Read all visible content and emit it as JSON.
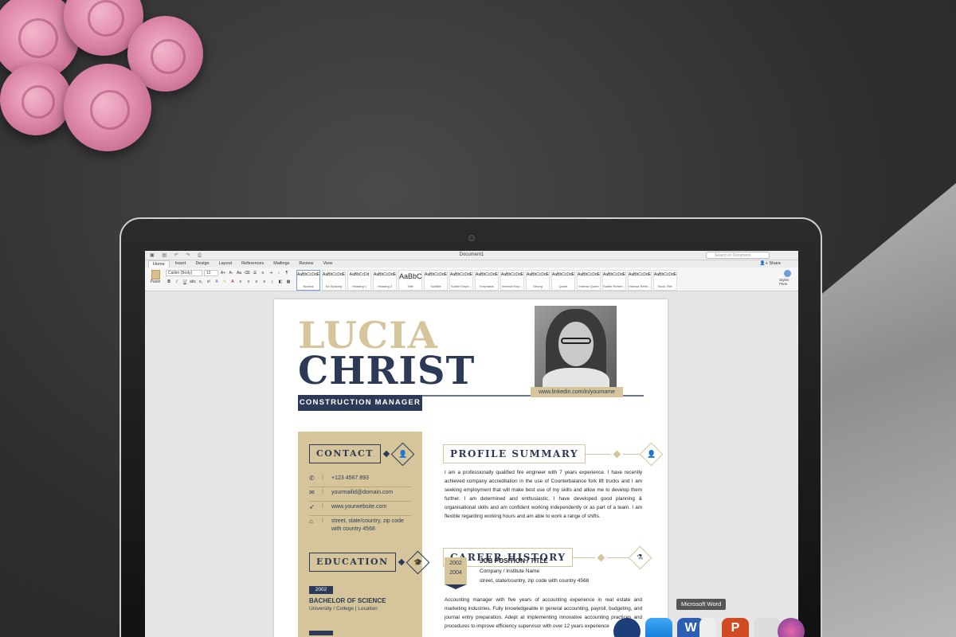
{
  "word": {
    "document_title": "Document1",
    "search_placeholder": "Search in Document",
    "tabs": [
      "Home",
      "Insert",
      "Design",
      "Layout",
      "References",
      "Mailings",
      "Review",
      "View"
    ],
    "share_label": "Share",
    "paste_label": "Paste",
    "font_name": "Calibri (Body)",
    "font_size": "12",
    "styles": [
      {
        "preview": "AaBbCcDdEe",
        "name": "Normal"
      },
      {
        "preview": "AaBbCcDdEe",
        "name": "No Spacing"
      },
      {
        "preview": "AaBbCcDd",
        "name": "Heading 1"
      },
      {
        "preview": "AaBbCcDdEe",
        "name": "Heading 2"
      },
      {
        "preview": "AaBbC",
        "name": "Title"
      },
      {
        "preview": "AaBbCcDdEe",
        "name": "Subtitle"
      },
      {
        "preview": "AaBbCcDdEe",
        "name": "Subtle Emph..."
      },
      {
        "preview": "AaBbCcDdEe",
        "name": "Emphasis"
      },
      {
        "preview": "AaBbCcDdEe",
        "name": "Intense Emp..."
      },
      {
        "preview": "AaBbCcDdEe",
        "name": "Strong"
      },
      {
        "preview": "AaBbCcDdEe",
        "name": "Quote"
      },
      {
        "preview": "AaBbCcDdEe",
        "name": "Intense Quote"
      },
      {
        "preview": "AaBbCcDdEe",
        "name": "Subtle Refere..."
      },
      {
        "preview": "AaBbCcDdEe",
        "name": "Intense Refer..."
      },
      {
        "preview": "AaBbCcDdEe",
        "name": "Book Title"
      }
    ],
    "styles_pane_label": "Styles Pane"
  },
  "resume": {
    "first_name": "LUCIA",
    "last_name": "CHRIST",
    "job_title": "CONSTRUCTION MANAGER",
    "linkedin": "www.linkedin.com/in/yourname",
    "contact_heading": "CONTACT",
    "contact": {
      "phone": "+123 4567 893",
      "email": "yourmailid@domain.com",
      "website": "www.yourwebsite.com",
      "address": "street, state/country, zip code with country 4568"
    },
    "education_heading": "EDUCATION",
    "education": {
      "year": "2002",
      "degree": "BACHELOR OF SCIENCE",
      "school": "University / College  |  Location"
    },
    "profile_heading": "PROFILE SUMMARY",
    "profile_text": "I am a professionally qualified fire engineer with 7 years experience. I have recently achieved company accreditation in the use of Counterbalance fork lift trucks and I am seeking employment that will make best use of my skills and allow me to develop them further. I am determined and enthusiastic, I have developed good planning & organisational skills and am confident working independently or as part of a team. I am flexible regarding working hours and am able to work a range of shifts.",
    "career_heading": "CAREER HISTORY",
    "job": {
      "year_start": "2002",
      "year_end": "2004",
      "title": "JOB POSITION / TITLE",
      "company": "Company / Institute Name",
      "address": "street, state/country, zip code with country 4568",
      "description": "Accounting manager with five years of accounting experience in real estate and marketing industries. Fully knowledgeable in general accounting, payroll, budgeting, and journal entry preparation. Adept at implementing innovative accounting practices and procedures to improve efficiency supervisor with over 12 years experience"
    }
  },
  "dock": {
    "tooltip": "Microsoft Word"
  },
  "colors": {
    "gold": "#d6c59a",
    "navy": "#2c3a58"
  },
  "icons": [
    "phone-icon",
    "mail-icon",
    "mouse-pointer-icon",
    "home-icon",
    "user-icon",
    "graduation-cap-icon",
    "flask-icon"
  ]
}
